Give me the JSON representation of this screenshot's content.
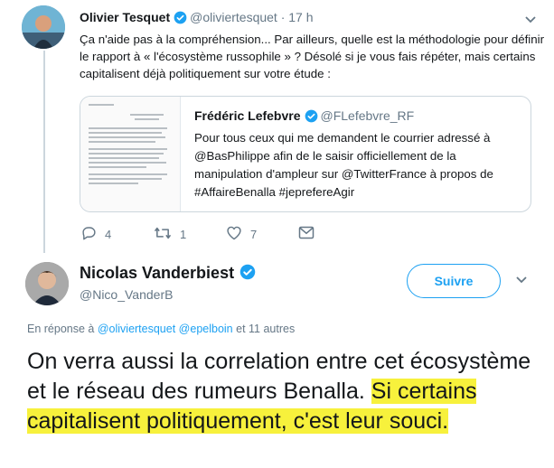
{
  "quoted_by_tweet": {
    "author_name": "Olivier Tesquet",
    "author_handle": "@oliviertesquet",
    "time": "· 17 h",
    "text": "Ça n'aide pas à la compréhension... Par ailleurs, quelle est la méthodologie pour définir le rapport à « l'écosystème russophile » ? Désolé si je vous fais répéter, mais certains capitalisent déjà politiquement sur votre étude :",
    "quote": {
      "author_name": "Frédéric Lefebvre",
      "author_handle": "@FLefebvre_RF",
      "text": "Pour tous ceux qui me demandent le courrier adressé à @BasPhilippe afin de le saisir officiellement de la manipulation d'ampleur sur @TwitterFrance à propos de #AffaireBenalla #jeprefereAgir"
    },
    "actions": {
      "reply_count": "4",
      "retweet_count": "1",
      "like_count": "7"
    }
  },
  "main_tweet": {
    "author_name": "Nicolas Vanderbiest",
    "author_handle": "@Nico_VanderB",
    "follow_label": "Suivre",
    "reply_prefix": "En réponse à",
    "reply_user1": "@oliviertesquet",
    "reply_user2": "@epelboin",
    "reply_suffix": "et 11 autres",
    "text_plain": "On verra aussi la correlation entre cet écosystème et le réseau des rumeurs Benalla. ",
    "text_highlight": "Si certains capitalisent politiquement, c'est leur souci."
  },
  "colors": {
    "accent": "#1da1f2",
    "secondary_text": "#657786",
    "highlight": "#f7f13c",
    "border": "#ccd6dd"
  },
  "icons": [
    "verified-badge-icon",
    "chevron-down-icon",
    "reply-icon",
    "retweet-icon",
    "like-icon",
    "dm-icon"
  ]
}
